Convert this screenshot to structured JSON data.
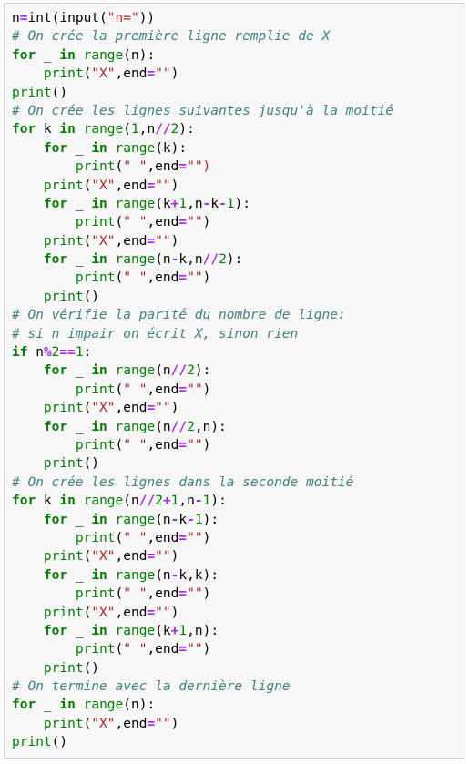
{
  "colors": {
    "background": "#f7f7f7",
    "border": "#cfcfcf",
    "keyword": "#008000",
    "builtin": "#008000",
    "operator": "#aa22ff",
    "string": "#ba2121",
    "number": "#008000",
    "comment": "#408080",
    "plain": "#000000"
  },
  "code": {
    "language": "python",
    "lines": [
      [
        [
          "pl",
          "n"
        ],
        [
          "op",
          "="
        ],
        [
          "pl",
          "int(input("
        ],
        [
          "str",
          "\"n=\""
        ],
        [
          "pl",
          "))"
        ]
      ],
      [
        [
          "cm",
          "# On crée la première ligne remplie de X"
        ]
      ],
      [
        [
          "kw",
          "for"
        ],
        [
          "pl",
          " _ "
        ],
        [
          "kw",
          "in"
        ],
        [
          "pl",
          " "
        ],
        [
          "bi",
          "range"
        ],
        [
          "pl",
          "(n):"
        ]
      ],
      [
        [
          "pl",
          "    "
        ],
        [
          "bi",
          "print"
        ],
        [
          "pl",
          "("
        ],
        [
          "str",
          "\"X\""
        ],
        [
          "pl",
          ",end"
        ],
        [
          "op",
          "="
        ],
        [
          "str",
          "\"\""
        ],
        [
          "pl",
          ")"
        ]
      ],
      [
        [
          "bi",
          "print"
        ],
        [
          "pl",
          "()"
        ]
      ],
      [
        [
          "cm",
          "# On crée les lignes suivantes jusqu'à la moitié"
        ]
      ],
      [
        [
          "kw",
          "for"
        ],
        [
          "pl",
          " k "
        ],
        [
          "kw",
          "in"
        ],
        [
          "pl",
          " "
        ],
        [
          "bi",
          "range"
        ],
        [
          "pl",
          "("
        ],
        [
          "num",
          "1"
        ],
        [
          "pl",
          ",n"
        ],
        [
          "op",
          "//"
        ],
        [
          "num",
          "2"
        ],
        [
          "pl",
          "):"
        ]
      ],
      [
        [
          "pl",
          "    "
        ],
        [
          "kw",
          "for"
        ],
        [
          "pl",
          " _ "
        ],
        [
          "kw",
          "in"
        ],
        [
          "pl",
          " "
        ],
        [
          "bi",
          "range"
        ],
        [
          "pl",
          "(k):"
        ]
      ],
      [
        [
          "pl",
          "        "
        ],
        [
          "bi",
          "print"
        ],
        [
          "pl",
          "("
        ],
        [
          "str",
          "\" \""
        ],
        [
          "pl",
          ",end"
        ],
        [
          "op",
          "="
        ],
        [
          "str",
          "\"\")"
        ]
      ],
      [
        [
          "pl",
          "    "
        ],
        [
          "bi",
          "print"
        ],
        [
          "pl",
          "("
        ],
        [
          "str",
          "\"X\""
        ],
        [
          "pl",
          ",end"
        ],
        [
          "op",
          "="
        ],
        [
          "str",
          "\"\""
        ],
        [
          "pl",
          ")"
        ]
      ],
      [
        [
          "pl",
          "    "
        ],
        [
          "kw",
          "for"
        ],
        [
          "pl",
          " _ "
        ],
        [
          "kw",
          "in"
        ],
        [
          "pl",
          " "
        ],
        [
          "bi",
          "range"
        ],
        [
          "pl",
          "(k"
        ],
        [
          "op",
          "+"
        ],
        [
          "num",
          "1"
        ],
        [
          "pl",
          ",n"
        ],
        [
          "op",
          "-"
        ],
        [
          "pl",
          "k"
        ],
        [
          "op",
          "-"
        ],
        [
          "num",
          "1"
        ],
        [
          "pl",
          "):"
        ]
      ],
      [
        [
          "pl",
          "        "
        ],
        [
          "bi",
          "print"
        ],
        [
          "pl",
          "("
        ],
        [
          "str",
          "\" \""
        ],
        [
          "pl",
          ",end"
        ],
        [
          "op",
          "="
        ],
        [
          "str",
          "\"\""
        ],
        [
          "pl",
          ")"
        ]
      ],
      [
        [
          "pl",
          "    "
        ],
        [
          "bi",
          "print"
        ],
        [
          "pl",
          "("
        ],
        [
          "str",
          "\"X\""
        ],
        [
          "pl",
          ",end"
        ],
        [
          "op",
          "="
        ],
        [
          "str",
          "\"\""
        ],
        [
          "pl",
          ")"
        ]
      ],
      [
        [
          "pl",
          "    "
        ],
        [
          "kw",
          "for"
        ],
        [
          "pl",
          " _ "
        ],
        [
          "kw",
          "in"
        ],
        [
          "pl",
          " "
        ],
        [
          "bi",
          "range"
        ],
        [
          "pl",
          "(n"
        ],
        [
          "op",
          "-"
        ],
        [
          "pl",
          "k,n"
        ],
        [
          "op",
          "//"
        ],
        [
          "num",
          "2"
        ],
        [
          "pl",
          "):"
        ]
      ],
      [
        [
          "pl",
          "        "
        ],
        [
          "bi",
          "print"
        ],
        [
          "pl",
          "("
        ],
        [
          "str",
          "\" \""
        ],
        [
          "pl",
          ",end"
        ],
        [
          "op",
          "="
        ],
        [
          "str",
          "\"\""
        ],
        [
          "pl",
          ")"
        ]
      ],
      [
        [
          "pl",
          "    "
        ],
        [
          "bi",
          "print"
        ],
        [
          "pl",
          "()"
        ]
      ],
      [
        [
          "cm",
          "# On vérifie la parité du nombre de ligne:"
        ]
      ],
      [
        [
          "cm",
          "# si n impair on écrit X, sinon rien"
        ]
      ],
      [
        [
          "kw",
          "if"
        ],
        [
          "pl",
          " n"
        ],
        [
          "op",
          "%"
        ],
        [
          "num",
          "2"
        ],
        [
          "op",
          "=="
        ],
        [
          "num",
          "1"
        ],
        [
          "pl",
          ":"
        ]
      ],
      [
        [
          "pl",
          "    "
        ],
        [
          "kw",
          "for"
        ],
        [
          "pl",
          " _ "
        ],
        [
          "kw",
          "in"
        ],
        [
          "pl",
          " "
        ],
        [
          "bi",
          "range"
        ],
        [
          "pl",
          "(n"
        ],
        [
          "op",
          "//"
        ],
        [
          "num",
          "2"
        ],
        [
          "pl",
          "):"
        ]
      ],
      [
        [
          "pl",
          "        "
        ],
        [
          "bi",
          "print"
        ],
        [
          "pl",
          "("
        ],
        [
          "str",
          "\" \""
        ],
        [
          "pl",
          ",end"
        ],
        [
          "op",
          "="
        ],
        [
          "str",
          "\"\""
        ],
        [
          "pl",
          ")"
        ]
      ],
      [
        [
          "pl",
          "    "
        ],
        [
          "bi",
          "print"
        ],
        [
          "pl",
          "("
        ],
        [
          "str",
          "\"X\""
        ],
        [
          "pl",
          ",end"
        ],
        [
          "op",
          "="
        ],
        [
          "str",
          "\"\""
        ],
        [
          "pl",
          ")"
        ]
      ],
      [
        [
          "pl",
          "    "
        ],
        [
          "kw",
          "for"
        ],
        [
          "pl",
          " _ "
        ],
        [
          "kw",
          "in"
        ],
        [
          "pl",
          " "
        ],
        [
          "bi",
          "range"
        ],
        [
          "pl",
          "(n"
        ],
        [
          "op",
          "//"
        ],
        [
          "num",
          "2"
        ],
        [
          "pl",
          ",n):"
        ]
      ],
      [
        [
          "pl",
          "        "
        ],
        [
          "bi",
          "print"
        ],
        [
          "pl",
          "("
        ],
        [
          "str",
          "\" \""
        ],
        [
          "pl",
          ",end"
        ],
        [
          "op",
          "="
        ],
        [
          "str",
          "\"\""
        ],
        [
          "pl",
          ")"
        ]
      ],
      [
        [
          "pl",
          "    "
        ],
        [
          "bi",
          "print"
        ],
        [
          "pl",
          "()"
        ]
      ],
      [
        [
          "cm",
          "# On crée les lignes dans la seconde moitié"
        ]
      ],
      [
        [
          "kw",
          "for"
        ],
        [
          "pl",
          " k "
        ],
        [
          "kw",
          "in"
        ],
        [
          "pl",
          " "
        ],
        [
          "bi",
          "range"
        ],
        [
          "pl",
          "(n"
        ],
        [
          "op",
          "//"
        ],
        [
          "num",
          "2"
        ],
        [
          "op",
          "+"
        ],
        [
          "num",
          "1"
        ],
        [
          "pl",
          ",n"
        ],
        [
          "op",
          "-"
        ],
        [
          "num",
          "1"
        ],
        [
          "pl",
          "):"
        ]
      ],
      [
        [
          "pl",
          "    "
        ],
        [
          "kw",
          "for"
        ],
        [
          "pl",
          " _ "
        ],
        [
          "kw",
          "in"
        ],
        [
          "pl",
          " "
        ],
        [
          "bi",
          "range"
        ],
        [
          "pl",
          "(n"
        ],
        [
          "op",
          "-"
        ],
        [
          "pl",
          "k"
        ],
        [
          "op",
          "-"
        ],
        [
          "num",
          "1"
        ],
        [
          "pl",
          "):"
        ]
      ],
      [
        [
          "pl",
          "        "
        ],
        [
          "bi",
          "print"
        ],
        [
          "pl",
          "("
        ],
        [
          "str",
          "\" \""
        ],
        [
          "pl",
          ",end"
        ],
        [
          "op",
          "="
        ],
        [
          "str",
          "\"\""
        ],
        [
          "pl",
          ")"
        ]
      ],
      [
        [
          "pl",
          "    "
        ],
        [
          "bi",
          "print"
        ],
        [
          "pl",
          "("
        ],
        [
          "str",
          "\"X\""
        ],
        [
          "pl",
          ",end"
        ],
        [
          "op",
          "="
        ],
        [
          "str",
          "\"\""
        ],
        [
          "pl",
          ")"
        ]
      ],
      [
        [
          "pl",
          "    "
        ],
        [
          "kw",
          "for"
        ],
        [
          "pl",
          " _ "
        ],
        [
          "kw",
          "in"
        ],
        [
          "pl",
          " "
        ],
        [
          "bi",
          "range"
        ],
        [
          "pl",
          "(n"
        ],
        [
          "op",
          "-"
        ],
        [
          "pl",
          "k,k):"
        ]
      ],
      [
        [
          "pl",
          "        "
        ],
        [
          "bi",
          "print"
        ],
        [
          "pl",
          "("
        ],
        [
          "str",
          "\" \""
        ],
        [
          "pl",
          ",end"
        ],
        [
          "op",
          "="
        ],
        [
          "str",
          "\"\""
        ],
        [
          "pl",
          ")"
        ]
      ],
      [
        [
          "pl",
          "    "
        ],
        [
          "bi",
          "print"
        ],
        [
          "pl",
          "("
        ],
        [
          "str",
          "\"X\""
        ],
        [
          "pl",
          ",end"
        ],
        [
          "op",
          "="
        ],
        [
          "str",
          "\"\""
        ],
        [
          "pl",
          ")"
        ]
      ],
      [
        [
          "pl",
          "    "
        ],
        [
          "kw",
          "for"
        ],
        [
          "pl",
          " _ "
        ],
        [
          "kw",
          "in"
        ],
        [
          "pl",
          " "
        ],
        [
          "bi",
          "range"
        ],
        [
          "pl",
          "(k"
        ],
        [
          "op",
          "+"
        ],
        [
          "num",
          "1"
        ],
        [
          "pl",
          ",n):"
        ]
      ],
      [
        [
          "pl",
          "        "
        ],
        [
          "bi",
          "print"
        ],
        [
          "pl",
          "("
        ],
        [
          "str",
          "\" \""
        ],
        [
          "pl",
          ",end"
        ],
        [
          "op",
          "="
        ],
        [
          "str",
          "\"\""
        ],
        [
          "pl",
          ")"
        ]
      ],
      [
        [
          "pl",
          "    "
        ],
        [
          "bi",
          "print"
        ],
        [
          "pl",
          "()"
        ]
      ],
      [
        [
          "cm",
          "# On termine avec la dernière ligne"
        ]
      ],
      [
        [
          "kw",
          "for"
        ],
        [
          "pl",
          " _ "
        ],
        [
          "kw",
          "in"
        ],
        [
          "pl",
          " "
        ],
        [
          "bi",
          "range"
        ],
        [
          "pl",
          "(n):"
        ]
      ],
      [
        [
          "pl",
          "    "
        ],
        [
          "bi",
          "print"
        ],
        [
          "pl",
          "("
        ],
        [
          "str",
          "\"X\""
        ],
        [
          "pl",
          ",end"
        ],
        [
          "op",
          "="
        ],
        [
          "str",
          "\"\""
        ],
        [
          "pl",
          ")"
        ]
      ],
      [
        [
          "bi",
          "print"
        ],
        [
          "pl",
          "()"
        ]
      ]
    ]
  }
}
